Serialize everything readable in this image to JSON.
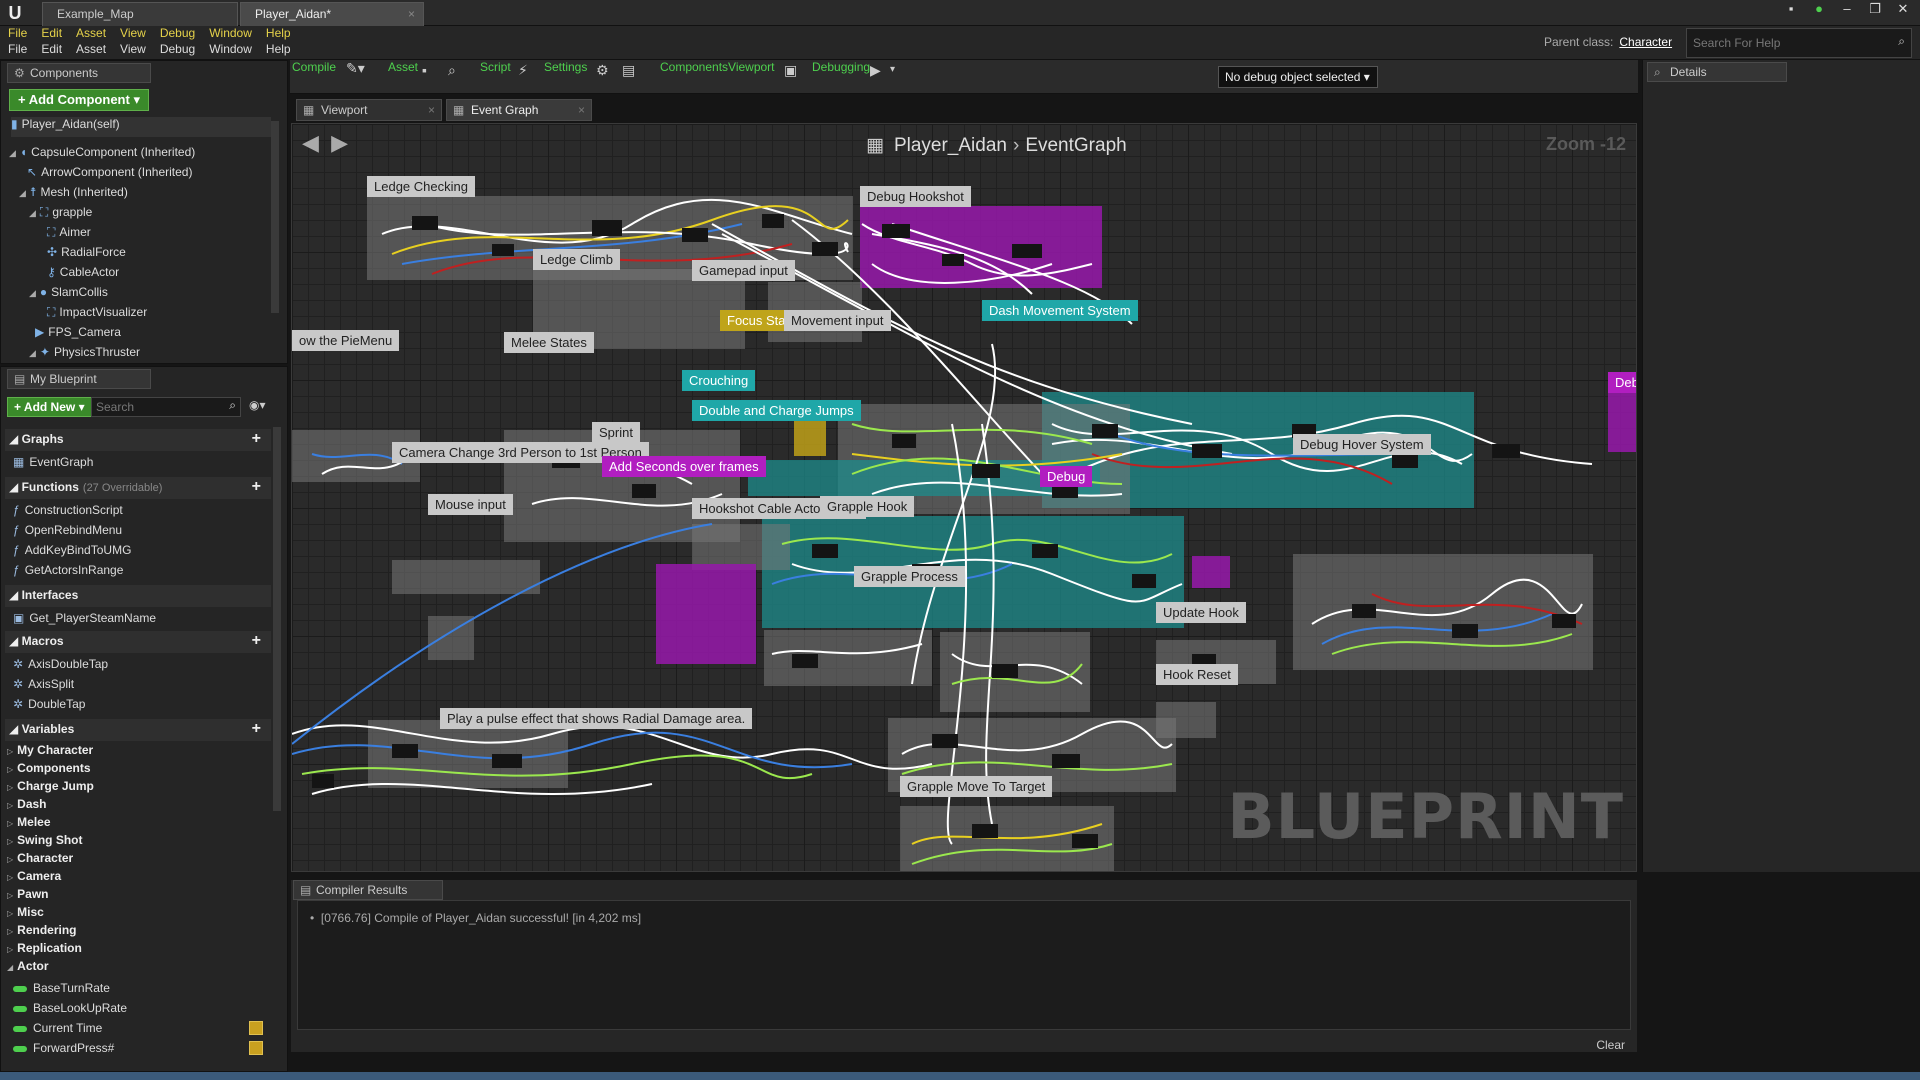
{
  "window": {
    "tabs": [
      {
        "label": "Example_Map"
      },
      {
        "label": "Player_Aidan*"
      }
    ]
  },
  "menu": [
    "File",
    "Edit",
    "Asset",
    "View",
    "Debug",
    "Window",
    "Help"
  ],
  "parent_class": {
    "label": "Parent class:",
    "value": "Character"
  },
  "help_search": {
    "placeholder": "Search For Help"
  },
  "components": {
    "tab": "Components",
    "add_label": "+ Add Component",
    "tree": [
      {
        "label": "Player_Aidan(self)",
        "depth": 0
      },
      {
        "label": "CapsuleComponent (Inherited)",
        "depth": 0
      },
      {
        "label": "ArrowComponent (Inherited)",
        "depth": 1
      },
      {
        "label": "Mesh (Inherited)",
        "depth": 1
      },
      {
        "label": "grapple",
        "depth": 2
      },
      {
        "label": "Aimer",
        "depth": 3
      },
      {
        "label": "RadialForce",
        "depth": 3
      },
      {
        "label": "CableActor",
        "depth": 3
      },
      {
        "label": "SlamCollis",
        "depth": 2
      },
      {
        "label": "ImpactVisualizer",
        "depth": 3
      },
      {
        "label": "FPS_Camera",
        "depth": 2
      },
      {
        "label": "PhysicsThruster",
        "depth": 2
      }
    ]
  },
  "my_blueprint": {
    "tab": "My Blueprint",
    "add_new": "+ Add New",
    "search_placeholder": "Search",
    "graphs": {
      "title": "Graphs",
      "items": [
        "EventGraph"
      ]
    },
    "functions": {
      "title": "Functions",
      "count": "(27 Overridable)",
      "items": [
        "ConstructionScript",
        "OpenRebindMenu",
        "AddKeyBindToUMG",
        "GetActorsInRange"
      ]
    },
    "interfaces": {
      "title": "Interfaces",
      "items": [
        "Get_PlayerSteamName"
      ]
    },
    "macros": {
      "title": "Macros",
      "items": [
        "AxisDoubleTap",
        "AxisSplit",
        "DoubleTap"
      ]
    },
    "variables": {
      "title": "Variables",
      "categories": [
        "My Character",
        "Components",
        "Charge Jump",
        "Dash",
        "Melee",
        "Swing Shot",
        "Character",
        "Camera",
        "Pawn",
        "Misc",
        "Rendering",
        "Replication",
        "Actor"
      ],
      "items": [
        "BaseTurnRate",
        "BaseLookUpRate",
        "Current Time",
        "ForwardPress#"
      ]
    }
  },
  "toolbar": {
    "items": [
      "Compile",
      "Asset",
      "Script",
      "Settings",
      "ComponentsViewport",
      "Debugging"
    ],
    "debug_select": "No debug object selected"
  },
  "graph_tabs": [
    "Viewport",
    "Event Graph"
  ],
  "graph": {
    "breadcrumb_root": "Player_Aidan",
    "breadcrumb_leaf": "EventGraph",
    "zoom": "Zoom -12",
    "watermark": "BLUEPRINT",
    "comments": [
      "Ledge Checking",
      "Debug Hookshot",
      "Gamepad input",
      "Ledge Climb",
      "Dash Movement System",
      "Focus State",
      "Movement input",
      "ow the PieMenu",
      "Melee States",
      "Crouching",
      "Double and Charge Jumps",
      "Sprint",
      "Camera Change 3rd Person to 1st Person",
      "Add Seconds over frames",
      "Debug",
      "Debug Hover System",
      "Mouse input",
      "Hookshot Cable Actor Initial",
      "Grapple Hook",
      "Update Hook",
      "Hook Reset",
      "Grapple Process",
      "Play a pulse effect that shows Radial Damage area.",
      "Grapple Move To Target",
      "Deb"
    ]
  },
  "details": {
    "tab": "Details"
  },
  "compiler": {
    "tab": "Compiler Results",
    "line": "[0766.76] Compile of Player_Aidan successful! [in 4,202 ms]",
    "clear": "Clear"
  },
  "colors": {
    "teal": "#1fa7a8",
    "magenta": "#b11ec0",
    "green": "#4ed04e",
    "wire_white": "#ffffff",
    "wire_yellow": "#e8d020",
    "wire_red": "#c02020",
    "wire_blue": "#3a7fe0",
    "wire_lime": "#9be84e"
  }
}
